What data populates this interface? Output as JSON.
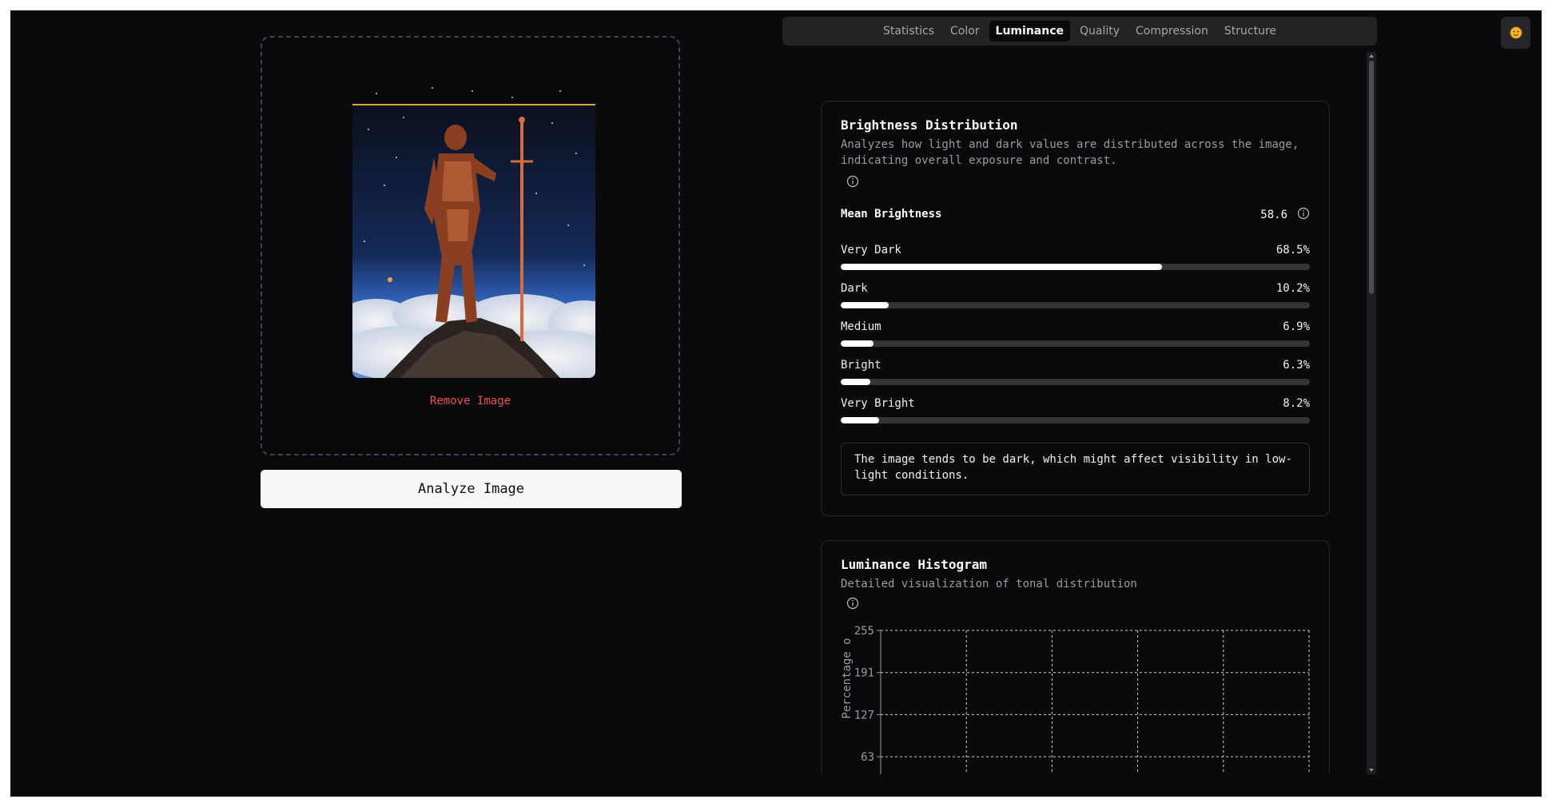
{
  "upload": {
    "remove_label": "Remove Image",
    "analyze_label": "Analyze Image"
  },
  "tabs": [
    {
      "label": "Statistics",
      "active": false
    },
    {
      "label": "Color",
      "active": false
    },
    {
      "label": "Luminance",
      "active": true
    },
    {
      "label": "Quality",
      "active": false
    },
    {
      "label": "Compression",
      "active": false
    },
    {
      "label": "Structure",
      "active": false
    }
  ],
  "theme_toggle": {
    "icon": "sun-icon"
  },
  "brightness": {
    "title": "Brightness Distribution",
    "description": "Analyzes how light and dark values are distributed across the image, indicating overall exposure and contrast.",
    "mean_label": "Mean Brightness",
    "mean_value": "58.6",
    "bars": [
      {
        "label": "Very Dark",
        "value": "68.5%",
        "fraction": 0.685
      },
      {
        "label": "Dark",
        "value": "10.2%",
        "fraction": 0.102
      },
      {
        "label": "Medium",
        "value": "6.9%",
        "fraction": 0.069
      },
      {
        "label": "Bright",
        "value": "6.3%",
        "fraction": 0.063
      },
      {
        "label": "Very Bright",
        "value": "8.2%",
        "fraction": 0.082
      }
    ],
    "note": "The image tends to be dark, which might affect visibility in low-light conditions."
  },
  "histogram": {
    "title": "Luminance Histogram",
    "description": "Detailed visualization of tonal distribution"
  },
  "chart_data": {
    "type": "area",
    "ylabel": "Percentage o",
    "y_ticks": [
      "255",
      "191",
      "127",
      "63"
    ],
    "ylim": [
      0,
      255
    ],
    "grid": true,
    "gridline_color": "#cfcfcf",
    "axis_color": "#9a9aa2"
  },
  "colors": {
    "background": "#0a0a0c",
    "accent_danger": "#ef5350",
    "bar_fill": "#ffffff",
    "bar_track": "#333338"
  }
}
